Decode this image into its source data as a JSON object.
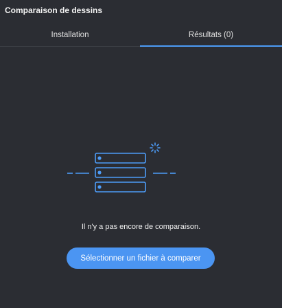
{
  "panel": {
    "title": "Comparaison de dessins"
  },
  "tabs": [
    {
      "label": "Installation",
      "active": false
    },
    {
      "label": "Résultats (0)",
      "active": true
    }
  ],
  "empty_state": {
    "illustration_icon": "server-stack-loading-icon",
    "message": "Il n'y a pas encore de comparaison.",
    "button_label": "Sélectionner un fichier à comparer"
  },
  "colors": {
    "background": "#2b2d33",
    "accent": "#4d9cf8",
    "button": "#4b95f2",
    "text": "#f0f0f0"
  }
}
